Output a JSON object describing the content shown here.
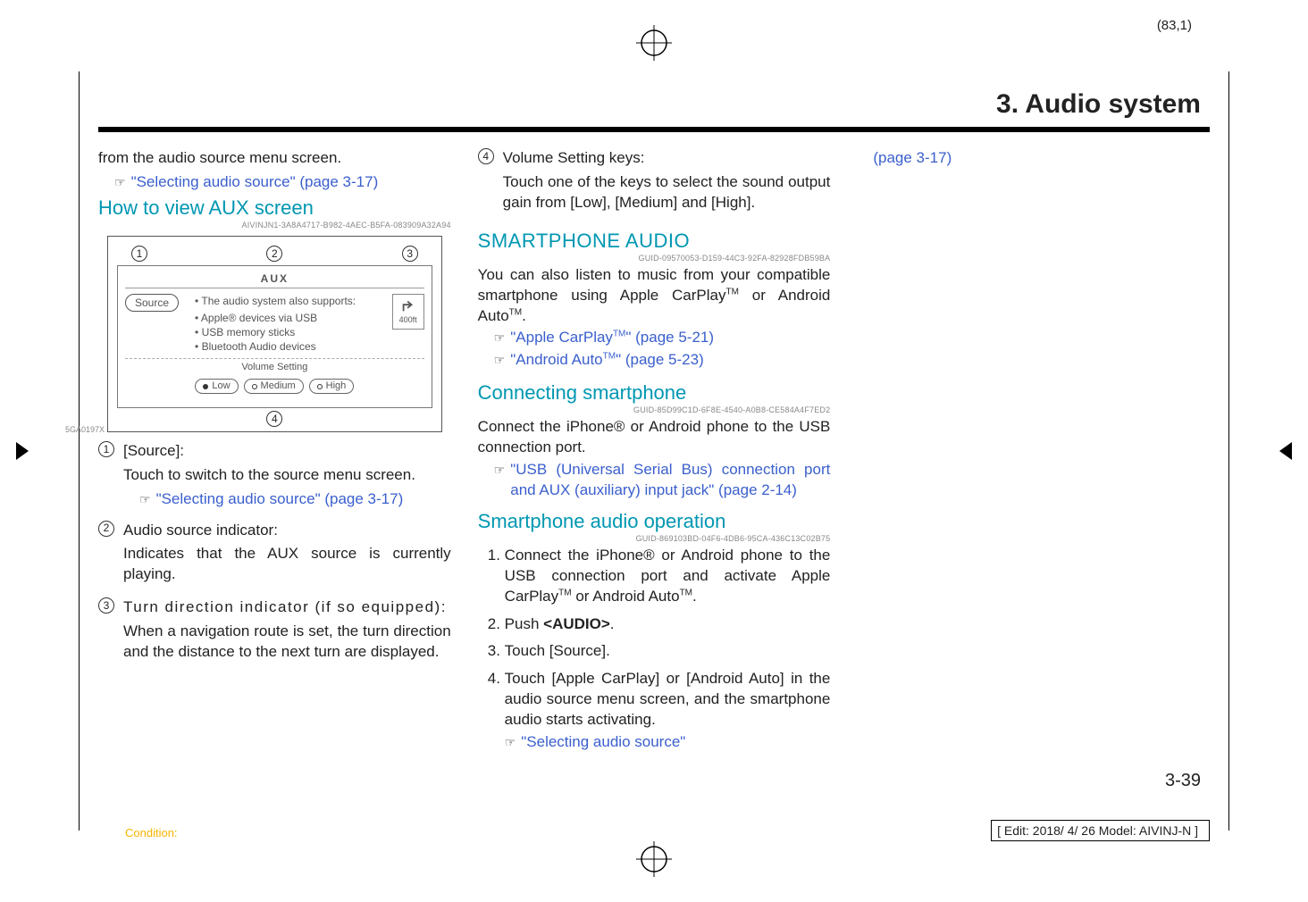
{
  "sheet": "(83,1)",
  "chapter": "3. Audio system",
  "col1": {
    "intro": "from the audio source menu screen.",
    "ref1": "\"Selecting audio source\" (page 3-17)",
    "h_view": "How to view AUX screen",
    "guid1": "AIVINJN1-3A8A4717-B982-4AEC-B5FA-083909A32A94",
    "fig": {
      "n1": "1",
      "n2": "2",
      "n3": "3",
      "n4": "4",
      "aux": "AUX",
      "source": "Source",
      "supports": "The audio system also supports:",
      "l1": "Apple® devices via USB",
      "l2": "USB memory sticks",
      "l3": "Bluetooth Audio devices",
      "vol": "Volume Setting",
      "low": "Low",
      "med": "Medium",
      "high": "High",
      "dist": "400ft",
      "code": "5GA0197X"
    },
    "item1_label": "[Source]:",
    "item1_text": "Touch to switch to the source menu screen.",
    "item1_ref": "\"Selecting audio source\" (page 3-17)",
    "item2_label": "Audio source indicator:",
    "item2_text": "Indicates that the AUX source is currently playing.",
    "item3_label": "Turn direction indicator (if so equipped):",
    "item3_text": "When a navigation route is set, the turn direction and the distance to the next turn are displayed."
  },
  "col2": {
    "item4_label": "Volume Setting keys:",
    "item4_text": "Touch one of the keys to select the sound output gain from [Low], [Medium] and [High].",
    "h_smart": "SMARTPHONE AUDIO",
    "guid2": "GUID-09570053-D159-44C3-92FA-82928FDB59BA",
    "smart_p1a": "You can also listen to music from your compatible smartphone using Apple CarPlay",
    "smart_p1b": " or Android Auto",
    "tm": "TM",
    "dot": ".",
    "ref_carplay": "\"Apple CarPlay",
    "ref_carplay2": "\" (page 5-21)",
    "ref_android": "\"Android Auto",
    "ref_android2": "\" (page 5-23)",
    "h_conn": "Connecting smartphone",
    "guid3": "GUID-85D99C1D-6F8E-4540-A0B8-CE584A4F7ED2",
    "conn_text": "Connect the iPhone® or Android phone to the USB connection port.",
    "ref_usb": "\"USB (Universal Serial Bus) connection port and AUX (auxiliary) input jack\" (page 2-14)",
    "h_op": "Smartphone audio operation",
    "guid4": "GUID-869103BD-04F6-4DB6-95CA-436C13C02B75",
    "op1a": "Connect the iPhone® or Android phone to the USB connection port and activate Apple CarPlay",
    "op1b": " or Android Auto",
    "op2": "Push ",
    "op2b": "<AUDIO>",
    "op3": "Touch [Source].",
    "op4": "Touch [Apple CarPlay] or [Android Auto] in the audio source menu screen, and the smartphone audio starts activating.",
    "op4_ref": "\"Selecting audio source\""
  },
  "col3": {
    "ref_page": "(page 3-17)"
  },
  "page_num": "3-39",
  "footer_left": "Condition:",
  "footer_right": "[ Edit: 2018/ 4/ 26    Model:  AIVINJ-N ]"
}
